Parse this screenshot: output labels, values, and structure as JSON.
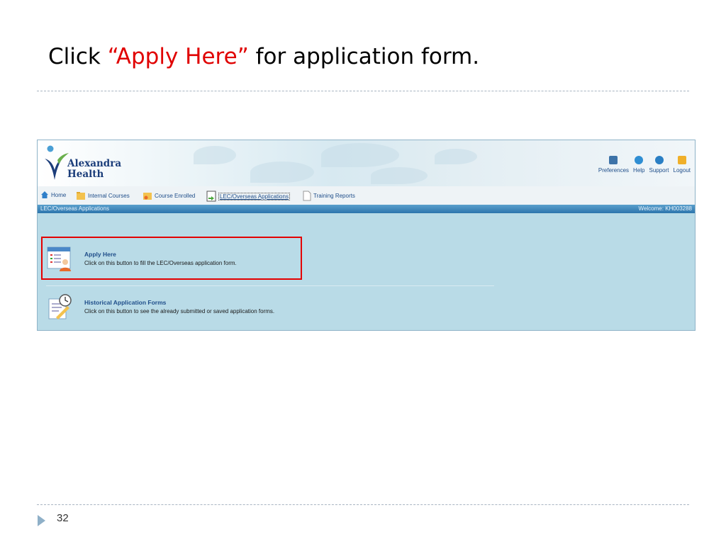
{
  "slide": {
    "title_before": "Click ",
    "title_highlight": "“Apply Here”",
    "title_after": " for application form.",
    "page_number": "32",
    "highlight_color": "#e00000"
  },
  "app": {
    "brand_line1": "Alexandra",
    "brand_line2": "Health",
    "top_links": [
      {
        "label": "Preferences",
        "icon": "gear-icon"
      },
      {
        "label": "Help",
        "icon": "info-icon"
      },
      {
        "label": "Support",
        "icon": "support-icon"
      },
      {
        "label": "Logout",
        "icon": "lock-icon"
      }
    ],
    "menu": [
      {
        "label": "Home",
        "icon": "home-icon"
      },
      {
        "label": "Internal Courses",
        "icon": "folder-icon"
      },
      {
        "label": "Course Enrolled",
        "icon": "folder-user-icon"
      },
      {
        "label": "LEC/Overseas Applications",
        "icon": "application-icon"
      },
      {
        "label": "Training Reports",
        "icon": "document-icon"
      }
    ],
    "status_left": "LEC/Overseas Applications",
    "status_right": "Welcome: KH003288",
    "options": [
      {
        "title": "Apply Here",
        "description": "Click on this button to fill the LEC/Overseas application form.",
        "icon": "form-user-icon"
      },
      {
        "title": "Historical Application Forms",
        "description": "Click on this button to see the already submitted or saved application forms.",
        "icon": "history-form-icon"
      }
    ]
  }
}
